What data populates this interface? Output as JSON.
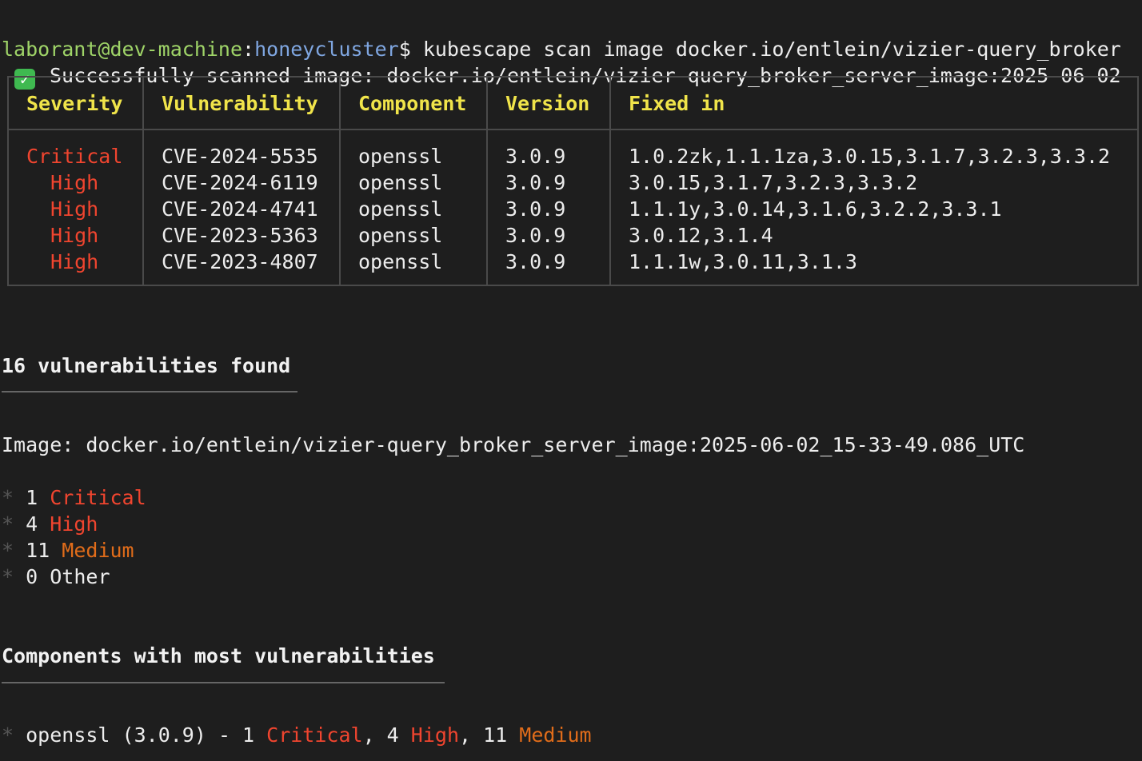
{
  "prompt": {
    "user_host": "laborant@dev-machine",
    "separator": ":",
    "cwd": "honeycluster",
    "symbol": "$",
    "command": " kubescape scan image docker.io/entlein/vizier-query_broker"
  },
  "success_line": {
    "icon": "check-mark-icon",
    "check_glyph": "✓",
    "text": "Successfully scanned image: docker.io/entlein/vizier-query_broker_server_image:2025-06-02"
  },
  "table": {
    "headers": [
      "Severity",
      "Vulnerability",
      "Component",
      "Version",
      "Fixed in"
    ],
    "rows": [
      {
        "severity": "Critical",
        "cve": "CVE-2024-5535",
        "component": "openssl",
        "version": "3.0.9",
        "fixed": "1.0.2zk,1.1.1za,3.0.15,3.1.7,3.2.3,3.3.2"
      },
      {
        "severity": "High",
        "cve": "CVE-2024-6119",
        "component": "openssl",
        "version": "3.0.9",
        "fixed": "3.0.15,3.1.7,3.2.3,3.3.2"
      },
      {
        "severity": "High",
        "cve": "CVE-2024-4741",
        "component": "openssl",
        "version": "3.0.9",
        "fixed": "1.1.1y,3.0.14,3.1.6,3.2.2,3.3.1"
      },
      {
        "severity": "High",
        "cve": "CVE-2023-5363",
        "component": "openssl",
        "version": "3.0.9",
        "fixed": "3.0.12,3.1.4"
      },
      {
        "severity": "High",
        "cve": "CVE-2023-4807",
        "component": "openssl",
        "version": "3.0.9",
        "fixed": "1.1.1w,3.0.11,3.1.3"
      }
    ]
  },
  "summary": {
    "title": "16 vulnerabilities found",
    "image_line": "Image: docker.io/entlein/vizier-query_broker_server_image:2025-06-02_15-33-49.086_UTC",
    "bullet": "*",
    "counts": [
      {
        "count": "1",
        "label": "Critical"
      },
      {
        "count": "4",
        "label": "High"
      },
      {
        "count": "11",
        "label": "Medium"
      },
      {
        "count": "0",
        "label": "Other"
      }
    ]
  },
  "components": {
    "title": "Components with most vulnerabilities",
    "bullet": "*",
    "item_prefix": "openssl (3.0.9) - 1 ",
    "critical_label": "Critical",
    "sep1": ", 4 ",
    "high_label": "High",
    "sep2": ", 11 ",
    "medium_label": "Medium"
  },
  "colors": {
    "background": "#1e1e1e",
    "user": "#9fd468",
    "path": "#7fa6e0",
    "header": "#f0e44a",
    "critical": "#f0452f",
    "high": "#f0452f",
    "medium": "#e06c1a"
  }
}
